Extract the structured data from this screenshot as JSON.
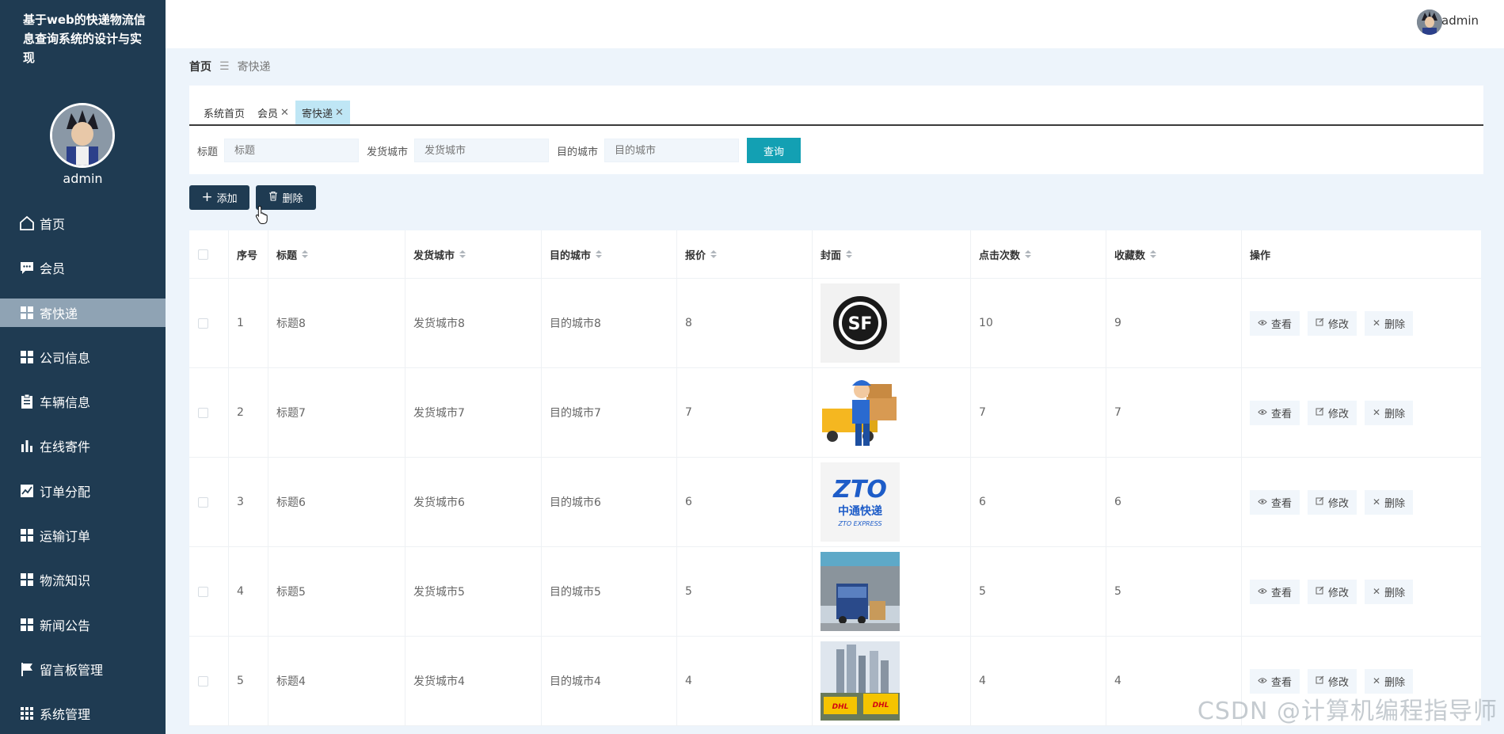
{
  "app": {
    "title": "基于web的快递物流信息查询系统的设计与实现"
  },
  "sidebar": {
    "username": "admin",
    "items": [
      {
        "label": "首页",
        "icon": "home-icon"
      },
      {
        "label": "会员",
        "icon": "comment-icon"
      },
      {
        "label": "寄快递",
        "icon": "grid-icon",
        "active": true
      },
      {
        "label": "公司信息",
        "icon": "grid-icon"
      },
      {
        "label": "车辆信息",
        "icon": "clipboard-icon"
      },
      {
        "label": "在线寄件",
        "icon": "bar-chart-icon"
      },
      {
        "label": "订单分配",
        "icon": "line-chart-icon"
      },
      {
        "label": "运输订单",
        "icon": "grid-icon"
      },
      {
        "label": "物流知识",
        "icon": "grid-icon"
      },
      {
        "label": "新闻公告",
        "icon": "grid-icon"
      },
      {
        "label": "留言板管理",
        "icon": "flag-icon"
      },
      {
        "label": "系统管理",
        "icon": "apps-icon"
      }
    ]
  },
  "topbar": {
    "username": "admin"
  },
  "breadcrumb": {
    "home": "首页",
    "current": "寄快递"
  },
  "tabs": [
    {
      "label": "系统首页",
      "closable": false
    },
    {
      "label": "会员",
      "closable": true
    },
    {
      "label": "寄快递",
      "closable": true,
      "active": true
    }
  ],
  "filters": {
    "title_label": "标题",
    "title_placeholder": "标题",
    "from_label": "发货城市",
    "from_placeholder": "发货城市",
    "to_label": "目的城市",
    "to_placeholder": "目的城市",
    "query_label": "查询"
  },
  "actions": {
    "add_label": "添加",
    "delete_label": "删除"
  },
  "table": {
    "headers": [
      "序号",
      "标题",
      "发货城市",
      "目的城市",
      "报价",
      "封面",
      "点击次数",
      "收藏数",
      "操作"
    ],
    "rows": [
      {
        "no": "1",
        "title": "标题8",
        "from": "发货城市8",
        "to": "目的城市8",
        "price": "8",
        "clicks": "10",
        "favs": "9"
      },
      {
        "no": "2",
        "title": "标题7",
        "from": "发货城市7",
        "to": "目的城市7",
        "price": "7",
        "clicks": "7",
        "favs": "7"
      },
      {
        "no": "3",
        "title": "标题6",
        "from": "发货城市6",
        "to": "目的城市6",
        "price": "6",
        "clicks": "6",
        "favs": "6"
      },
      {
        "no": "4",
        "title": "标题5",
        "from": "发货城市5",
        "to": "目的城市5",
        "price": "5",
        "clicks": "5",
        "favs": "5"
      },
      {
        "no": "5",
        "title": "标题4",
        "from": "发货城市4",
        "to": "目的城市4",
        "price": "4",
        "clicks": "4",
        "favs": "4"
      }
    ],
    "op_view": "查看",
    "op_edit": "修改",
    "op_delete": "删除",
    "cover_texts": {
      "sf": "SF",
      "zto_logo": "ZTO",
      "zto_cn": "中通快递",
      "zto_en": "ZTO EXPRESS",
      "dhl": "DHL"
    }
  },
  "watermark": "CSDN @计算机编程指导师",
  "colors": {
    "sidebar": "#1f3b52",
    "accent": "#13a0b3",
    "active_tab": "#bfe6f5"
  }
}
